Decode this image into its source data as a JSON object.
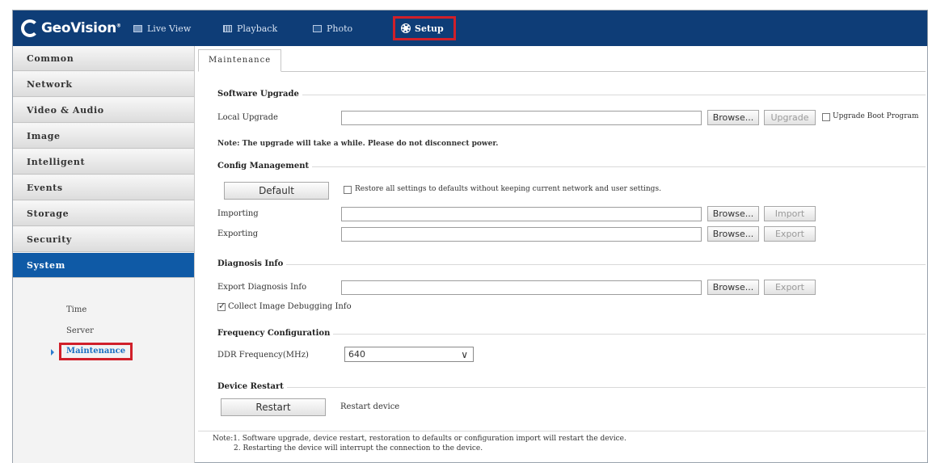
{
  "brand": {
    "name": "GeoVision",
    "trademark": "®"
  },
  "nav": [
    {
      "label": "Live View",
      "icon": "monitor-icon"
    },
    {
      "label": "Playback",
      "icon": "playback-icon"
    },
    {
      "label": "Photo",
      "icon": "photo-icon"
    },
    {
      "label": "Setup",
      "icon": "gear-icon"
    }
  ],
  "sidebar": {
    "items": [
      "Common",
      "Network",
      "Video & Audio",
      "Image",
      "Intelligent",
      "Events",
      "Storage",
      "Security",
      "System"
    ],
    "active": "System",
    "subitems": [
      "Time",
      "Server",
      "Maintenance"
    ],
    "current_subitem": "Maintenance"
  },
  "tab": "Maintenance",
  "software_upgrade": {
    "title": "Software Upgrade",
    "local_upgrade_label": "Local Upgrade",
    "local_upgrade_value": "",
    "browse": "Browse...",
    "upgrade": "Upgrade",
    "boot_program_label": "Upgrade Boot Program",
    "note": "Note: The upgrade will take a while. Please do not disconnect power."
  },
  "config_management": {
    "title": "Config Management",
    "default_button": "Default",
    "restore_label": "Restore all settings to defaults without keeping current network and user settings.",
    "importing_label": "Importing",
    "importing_value": "",
    "exporting_label": "Exporting",
    "exporting_value": "",
    "browse": "Browse...",
    "import": "Import",
    "export": "Export"
  },
  "diagnosis_info": {
    "title": "Diagnosis Info",
    "export_label": "Export Diagnosis Info",
    "export_value": "",
    "browse": "Browse...",
    "export": "Export",
    "collect_label": "Collect Image Debugging Info",
    "collect_checked": true
  },
  "frequency_configuration": {
    "title": "Frequency Configuration",
    "ddr_label": "DDR Frequency(MHz)",
    "ddr_value": "640"
  },
  "device_restart": {
    "title": "Device Restart",
    "restart_button": "Restart",
    "restart_label": "Restart device"
  },
  "footer_notes": {
    "line1": "Note:1. Software upgrade, device restart, restoration to defaults or configuration import will restart the device.",
    "line2": "2. Restarting the device will interrupt the connection to the device."
  }
}
